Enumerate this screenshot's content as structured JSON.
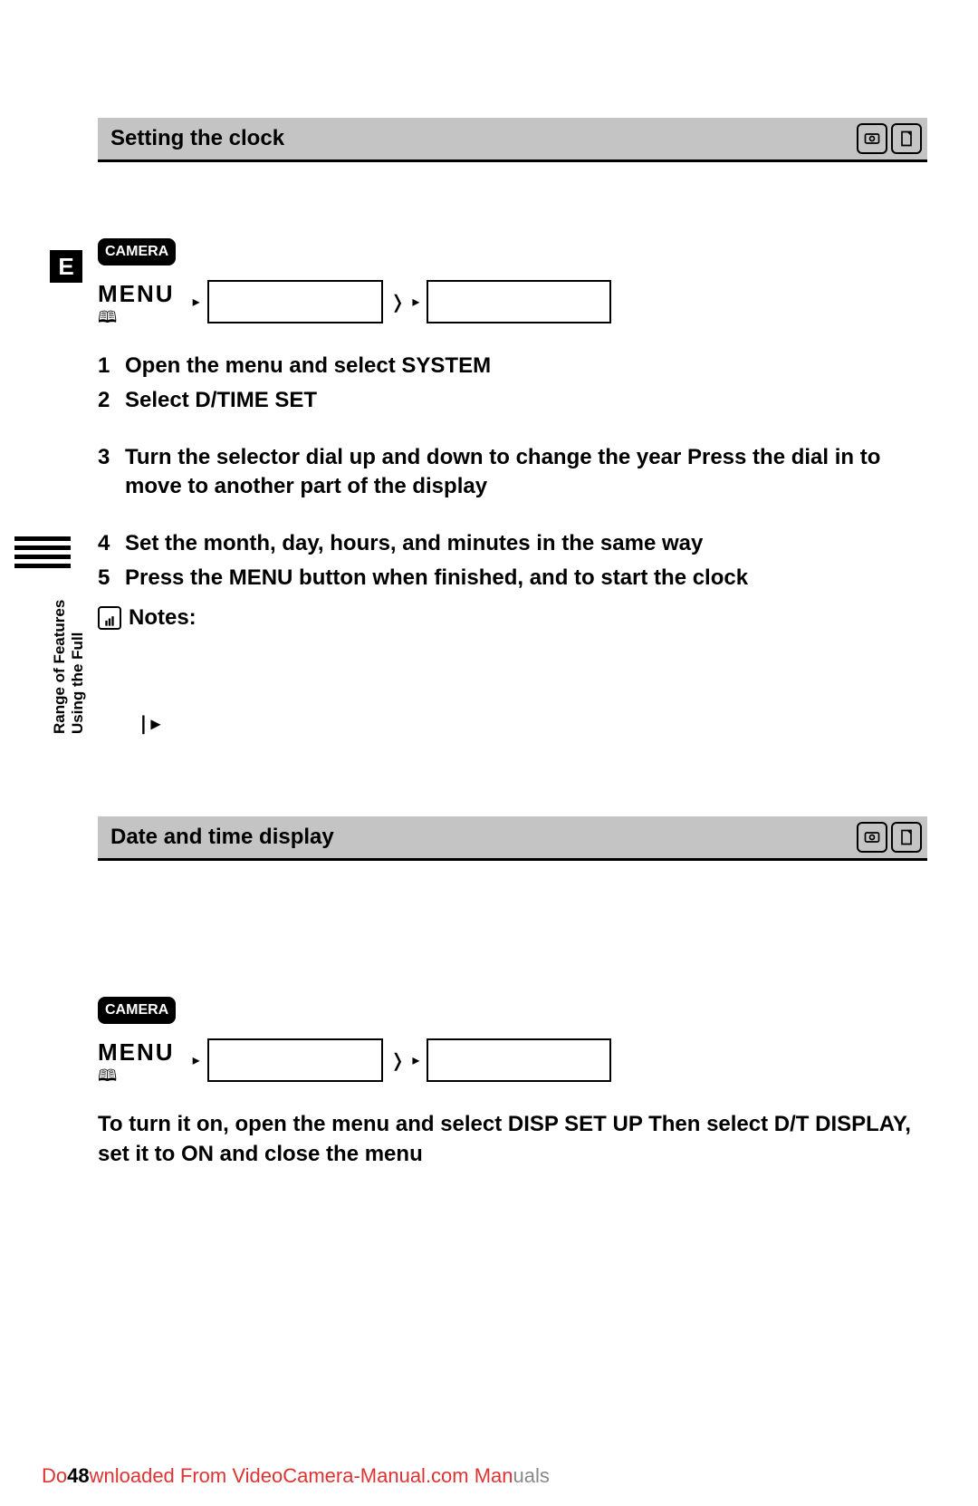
{
  "page_letter": "E",
  "sidebar": {
    "line1": "Using the Full",
    "line2": "Range of Features"
  },
  "section1": {
    "title": "Setting the clock",
    "camera_tag": "CAMERA",
    "menu_label": "MENU",
    "steps": [
      {
        "num": "1",
        "text": "Open the menu and select SYSTEM"
      },
      {
        "num": "2",
        "text": "Select D/TIME SET"
      },
      {
        "num": "3",
        "text": "Turn the selector dial up and down to change the year  Press the dial in to move to another part of the display"
      },
      {
        "num": "4",
        "text": "Set the month, day, hours, and minutes in the same way"
      },
      {
        "num": "5",
        "text": "Press the MENU button when finished, and to start the clock"
      }
    ],
    "notes_label": "Notes:"
  },
  "section2": {
    "title": "Date and time display",
    "camera_tag": "CAMERA",
    "menu_label": "MENU",
    "instruction": "To turn it on, open the menu and select DISP SET UP  Then select D/T DISPLAY, set it to ON and close the menu"
  },
  "footer": {
    "page_number": "48",
    "prefix": "Do",
    "red": "wnloaded From VideoCamera-Manual.com Man",
    "suffix": "uals"
  }
}
